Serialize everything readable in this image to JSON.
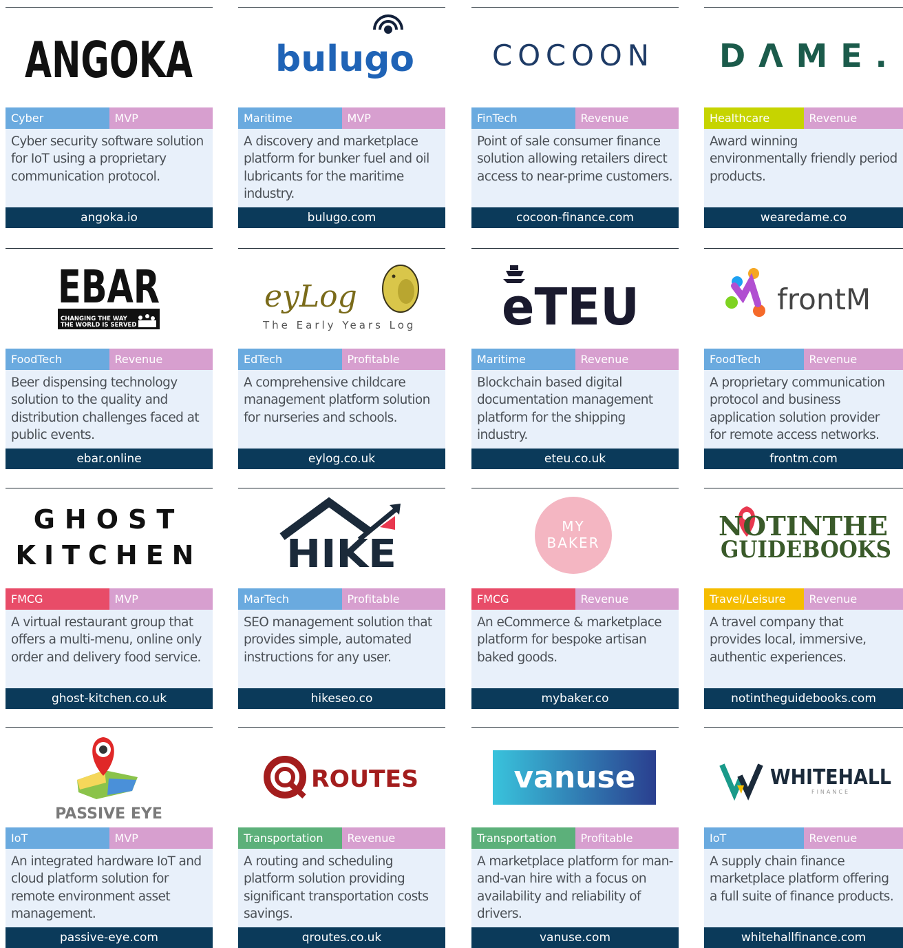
{
  "colors": {
    "sector_blue": "#6aaadf",
    "stage_pink": "#d79fcf",
    "healthcare_green": "#c6d400",
    "fmcg_red": "#e84c68",
    "travel_yellow": "#f5bd00",
    "transport_green": "#5cb07a",
    "description_bg": "#e8f0fa",
    "url_bar": "#0b3a5a"
  },
  "companies": [
    {
      "logo_text": "ANGOKA",
      "logo_icon": "angoka-wordmark",
      "sector": "Cyber",
      "sector_color": "#6aaadf",
      "stage": "MVP",
      "description": "Cyber security software solution for IoT using a proprietary communication protocol.",
      "url": "angoka.io"
    },
    {
      "logo_text": "bulugo",
      "logo_icon": "bulugo-signal-logo",
      "sector": "Maritime",
      "sector_color": "#6aaadf",
      "stage": "MVP",
      "description": "A discovery and marketplace platform for bunker fuel and oil lubricants for the maritime industry.",
      "url": "bulugo.com"
    },
    {
      "logo_text": "COCOON",
      "logo_icon": "cocoon-wordmark",
      "sector": "FinTech",
      "sector_color": "#6aaadf",
      "stage": "Revenue",
      "description": "Point of sale consumer finance solution allowing retailers direct access to near-prime customers.",
      "url": "cocoon-finance.com"
    },
    {
      "logo_text": "DΛME.",
      "logo_icon": "dame-wordmark",
      "sector": "Healthcare",
      "sector_color": "#c6d400",
      "stage": "Revenue",
      "description": "Award winning environmentally friendly period products.",
      "url": "wearedame.co"
    },
    {
      "logo_text": "EBAR",
      "logo_sub": "CHANGING THE WAY THE WORLD IS SERVED",
      "logo_icon": "ebar-logo",
      "sector": "FoodTech",
      "sector_color": "#6aaadf",
      "stage": "Revenue",
      "description": "Beer dispensing technology solution to the quality and distribution challenges faced at public events.",
      "url": "ebar.online"
    },
    {
      "logo_text": "eyLog",
      "logo_sub": "The Early Years Log",
      "logo_icon": "elephant-icon",
      "sector": "EdTech",
      "sector_color": "#6aaadf",
      "stage": "Profitable",
      "description": "A comprehensive childcare management platform solution for nurseries and schools.",
      "url": "eylog.co.uk"
    },
    {
      "logo_text": "eTEU",
      "logo_icon": "ship-icon",
      "sector": "Maritime",
      "sector_color": "#6aaadf",
      "stage": "Revenue",
      "description": "Blockchain based digital documentation management platform for the shipping industry.",
      "url": "eteu.co.uk"
    },
    {
      "logo_text": "frontM",
      "logo_icon": "frontm-molecule-logo",
      "sector": "FoodTech",
      "sector_color": "#6aaadf",
      "stage": "Revenue",
      "description": "A proprietary communication protocol and business application solution provider for remote access networks.",
      "url": "frontm.com"
    },
    {
      "logo_text": "GHOST",
      "logo_sub": "KITCHEN",
      "logo_icon": "ghost-kitchen-wordmark",
      "sector": "FMCG",
      "sector_color": "#e84c68",
      "stage": "MVP",
      "description": "A virtual restaurant group  that offers a multi-menu, online only order and delivery food service.",
      "url": "ghost-kitchen.co.uk"
    },
    {
      "logo_text": "HIKE",
      "logo_icon": "hike-arrow-logo",
      "sector": "MarTech",
      "sector_color": "#6aaadf",
      "stage": "Profitable",
      "description": "SEO management solution that provides simple, automated instructions for any user.",
      "url": "hikeseo.co"
    },
    {
      "logo_text": "MY",
      "logo_sub": "BAKER",
      "logo_icon": "mybaker-circle-logo",
      "sector": "FMCG",
      "sector_color": "#e84c68",
      "stage": "Revenue",
      "description": "An eCommerce & marketplace platform for bespoke artisan baked goods.",
      "url": "mybaker.co"
    },
    {
      "logo_text": "NOTINTHE",
      "logo_sub": "GUIDEBOOKS",
      "logo_icon": "map-pin-icon",
      "sector": "Travel/Leisure",
      "sector_color": "#f5bd00",
      "stage": "Revenue",
      "description": "A travel company that provides local, immersive, authentic experiences.",
      "url": "notintheguidebooks.com"
    },
    {
      "logo_text": "PASSIVE EYE",
      "logo_icon": "map-pin-icon",
      "sector": "IoT",
      "sector_color": "#6aaadf",
      "stage": "MVP",
      "description": "An integrated hardware IoT and cloud platform solution for remote environment asset management.",
      "url": "passive-eye.com"
    },
    {
      "logo_text": "ROUTES",
      "logo_icon": "qroutes-q-icon",
      "sector": "Transportation",
      "sector_color": "#5cb07a",
      "stage": "Revenue",
      "description": "A routing and scheduling platform solution providing significant transportation costs savings.",
      "url": "qroutes.co.uk"
    },
    {
      "logo_text": "vanuse",
      "logo_icon": "vanuse-banner-logo",
      "sector": "Transportation",
      "sector_color": "#5cb07a",
      "stage": "Profitable",
      "description": "A marketplace platform for man-and-van hire with a focus on availability and reliability of drivers.",
      "url": "vanuse.com"
    },
    {
      "logo_text": "WHITEHALL",
      "logo_sub": "FINANCE",
      "logo_icon": "whitehall-w-icon",
      "sector": "IoT",
      "sector_color": "#6aaadf",
      "stage": "Revenue",
      "description": "A supply chain finance marketplace platform offering a full suite of finance products.",
      "url": "whitehallfinance.com"
    }
  ]
}
